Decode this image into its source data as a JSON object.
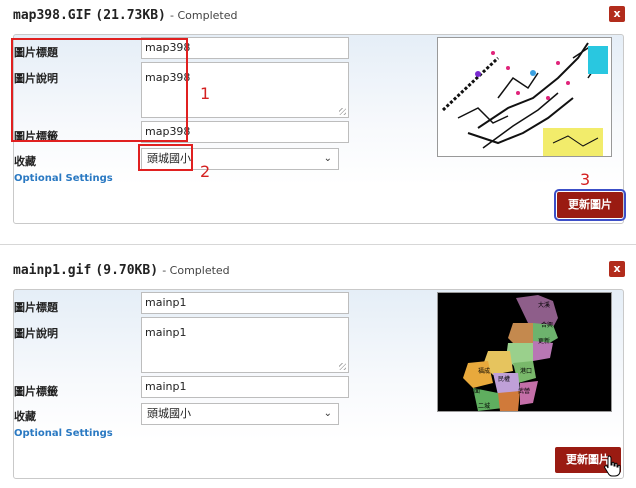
{
  "items": [
    {
      "filename": "map398.GIF",
      "size": "(21.73KB)",
      "status": "- Completed",
      "close_label": "x",
      "labels": {
        "title": "圖片標題",
        "description": "圖片說明",
        "tags": "圖片標籤",
        "collection": "收藏"
      },
      "values": {
        "title": "map398",
        "description": "map398",
        "tags": "map398",
        "collection": "頭城國小"
      },
      "optional_settings": "Optional Settings",
      "update_button": "更新圖片"
    },
    {
      "filename": "mainp1.gif",
      "size": "(9.70KB)",
      "status": "- Completed",
      "close_label": "x",
      "labels": {
        "title": "圖片標題",
        "description": "圖片說明",
        "tags": "圖片標籤",
        "collection": "收藏"
      },
      "values": {
        "title": "mainp1",
        "description": "mainp1",
        "tags": "mainp1",
        "collection": "頭城國小"
      },
      "optional_settings": "Optional Settings",
      "update_button": "更新圖片"
    }
  ],
  "annotations": {
    "one": "1",
    "two": "2",
    "three": "3"
  },
  "colors": {
    "annotation_red": "#e02020",
    "button_red": "#9a1b12",
    "link_blue": "#2a79c2",
    "focus_blue": "#3c4fc7"
  },
  "icons": {
    "cursor": "hand-pointer-icon",
    "resize": "resize-grip-icon",
    "chevron": "chevron-down-icon"
  }
}
